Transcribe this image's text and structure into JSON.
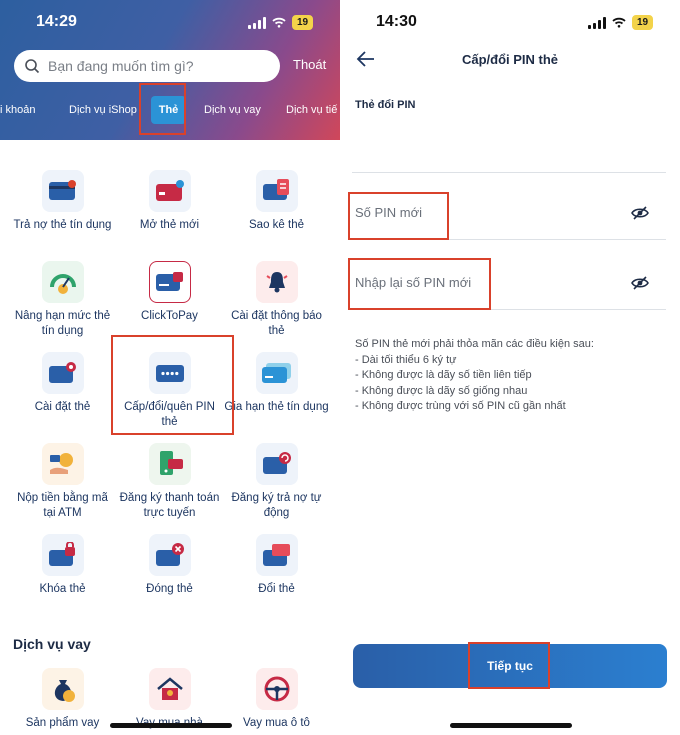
{
  "left": {
    "status": {
      "time": "14:29",
      "battery": "19"
    },
    "search": {
      "placeholder": "Bạn đang muốn tìm gì?"
    },
    "logout_label": "Thoát",
    "tabs": [
      "i khoản",
      "Dịch vụ iShop",
      "Thẻ",
      "Dịch vụ vay",
      "Dịch vụ tiế"
    ],
    "active_tab": "Thẻ",
    "items": [
      {
        "label": "Trả nợ thẻ tín dụng",
        "icon": "card-payment-icon"
      },
      {
        "label": "Mở thẻ mới",
        "icon": "new-card-icon"
      },
      {
        "label": "Sao kê thẻ",
        "icon": "statement-icon"
      },
      {
        "label": "Nâng hạn mức thẻ tín dụng",
        "icon": "limit-gauge-icon"
      },
      {
        "label": "ClickToPay",
        "icon": "clicktopay-icon"
      },
      {
        "label": "Cài đặt thông báo thẻ",
        "icon": "bell-icon"
      },
      {
        "label": "Cài đặt thẻ",
        "icon": "card-settings-icon"
      },
      {
        "label": "Cấp/đổi/quên PIN thẻ",
        "icon": "pin-icon"
      },
      {
        "label": "Gia hạn thẻ tín dụng",
        "icon": "card-renew-icon"
      },
      {
        "label": "Nộp tiền bằng mã tại ATM",
        "icon": "atm-deposit-icon"
      },
      {
        "label": "Đăng ký thanh toán trực tuyến",
        "icon": "online-payment-icon"
      },
      {
        "label": "Đăng ký trả nợ tự động",
        "icon": "auto-pay-icon"
      },
      {
        "label": "Khóa thẻ",
        "icon": "lock-card-icon"
      },
      {
        "label": "Đóng thẻ",
        "icon": "close-card-icon"
      },
      {
        "label": "Đổi thẻ",
        "icon": "change-card-icon"
      }
    ],
    "section_loan": "Dịch vụ vay",
    "loan_items": [
      {
        "label": "Sản phẩm vay",
        "icon": "money-bag-icon"
      },
      {
        "label": "Vay mua nhà",
        "icon": "house-icon"
      },
      {
        "label": "Vay mua ô tô",
        "icon": "steering-wheel-icon"
      }
    ]
  },
  "right": {
    "status": {
      "time": "14:30",
      "battery": "19"
    },
    "title": "Cấp/đổi PIN thẻ",
    "card_label": "Thẻ đổi PIN",
    "new_pin_placeholder": "Số PIN mới",
    "confirm_pin_placeholder": "Nhập lại số PIN mới",
    "rules": [
      "Số PIN thẻ mới phải thỏa mãn các điều kiện sau:",
      "- Dài tối thiểu 6 ký tự",
      "- Không được là dãy số tiền liên tiếp",
      "- Không được là dãy số giống nhau",
      "- Không được trùng với số PIN cũ gần nhất"
    ],
    "continue_label": "Tiếp tục"
  },
  "colors": {
    "accent": "#2b7fd0",
    "highlight": "#d9412b",
    "text_dark": "#1d3661"
  }
}
